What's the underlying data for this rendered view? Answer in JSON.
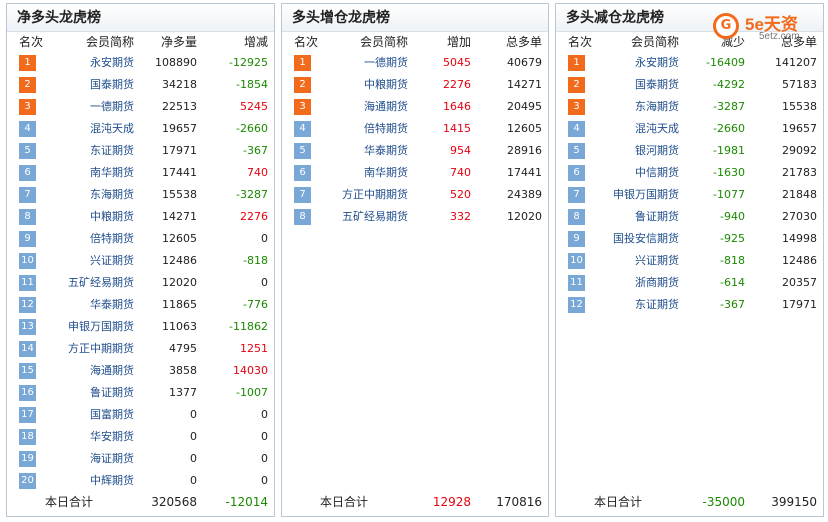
{
  "panels": [
    {
      "title": "净多头龙虎榜",
      "headers": [
        "名次",
        "会员简称",
        "净多量",
        "增减"
      ],
      "rows": [
        {
          "rank": "1",
          "name": "永安期货",
          "v1": "108890",
          "v2": "-12925",
          "c2": "green"
        },
        {
          "rank": "2",
          "name": "国泰期货",
          "v1": "34218",
          "v2": "-1854",
          "c2": "green"
        },
        {
          "rank": "3",
          "name": "一德期货",
          "v1": "22513",
          "v2": "5245",
          "c2": "red"
        },
        {
          "rank": "4",
          "name": "混沌天成",
          "v1": "19657",
          "v2": "-2660",
          "c2": "green"
        },
        {
          "rank": "5",
          "name": "东证期货",
          "v1": "17971",
          "v2": "-367",
          "c2": "green"
        },
        {
          "rank": "6",
          "name": "南华期货",
          "v1": "17441",
          "v2": "740",
          "c2": "red"
        },
        {
          "rank": "7",
          "name": "东海期货",
          "v1": "15538",
          "v2": "-3287",
          "c2": "green"
        },
        {
          "rank": "8",
          "name": "中粮期货",
          "v1": "14271",
          "v2": "2276",
          "c2": "red"
        },
        {
          "rank": "9",
          "name": "倍特期货",
          "v1": "12605",
          "v2": "0",
          "c2": "black"
        },
        {
          "rank": "10",
          "name": "兴证期货",
          "v1": "12486",
          "v2": "-818",
          "c2": "green"
        },
        {
          "rank": "11",
          "name": "五矿经易期货",
          "v1": "12020",
          "v2": "0",
          "c2": "black"
        },
        {
          "rank": "12",
          "name": "华泰期货",
          "v1": "11865",
          "v2": "-776",
          "c2": "green"
        },
        {
          "rank": "13",
          "name": "申银万国期货",
          "v1": "11063",
          "v2": "-11862",
          "c2": "green"
        },
        {
          "rank": "14",
          "name": "方正中期期货",
          "v1": "4795",
          "v2": "1251",
          "c2": "red"
        },
        {
          "rank": "15",
          "name": "海通期货",
          "v1": "3858",
          "v2": "14030",
          "c2": "red"
        },
        {
          "rank": "16",
          "name": "鲁证期货",
          "v1": "1377",
          "v2": "-1007",
          "c2": "green"
        },
        {
          "rank": "17",
          "name": "国富期货",
          "v1": "0",
          "v2": "0",
          "c2": "black"
        },
        {
          "rank": "18",
          "name": "华安期货",
          "v1": "0",
          "v2": "0",
          "c2": "black"
        },
        {
          "rank": "19",
          "name": "海证期货",
          "v1": "0",
          "v2": "0",
          "c2": "black"
        },
        {
          "rank": "20",
          "name": "中辉期货",
          "v1": "0",
          "v2": "0",
          "c2": "black"
        }
      ],
      "total": {
        "label": "本日合计",
        "v1": "320568",
        "v2": "-12014",
        "c1": "black",
        "c2": "green"
      }
    },
    {
      "title": "多头增仓龙虎榜",
      "headers": [
        "名次",
        "会员简称",
        "增加",
        "总多单"
      ],
      "rows": [
        {
          "rank": "1",
          "name": "一德期货",
          "v1": "5045",
          "v2": "40679",
          "c1": "red"
        },
        {
          "rank": "2",
          "name": "中粮期货",
          "v1": "2276",
          "v2": "14271",
          "c1": "red"
        },
        {
          "rank": "3",
          "name": "海通期货",
          "v1": "1646",
          "v2": "20495",
          "c1": "red"
        },
        {
          "rank": "4",
          "name": "倍特期货",
          "v1": "1415",
          "v2": "12605",
          "c1": "red"
        },
        {
          "rank": "5",
          "name": "华泰期货",
          "v1": "954",
          "v2": "28916",
          "c1": "red"
        },
        {
          "rank": "6",
          "name": "南华期货",
          "v1": "740",
          "v2": "17441",
          "c1": "red"
        },
        {
          "rank": "7",
          "name": "方正中期期货",
          "v1": "520",
          "v2": "24389",
          "c1": "red"
        },
        {
          "rank": "8",
          "name": "五矿经易期货",
          "v1": "332",
          "v2": "12020",
          "c1": "red"
        }
      ],
      "total": {
        "label": "本日合计",
        "v1": "12928",
        "v2": "170816",
        "c1": "red",
        "c2": "black"
      }
    },
    {
      "title": "多头减仓龙虎榜",
      "headers": [
        "名次",
        "会员简称",
        "减少",
        "总多单"
      ],
      "rows": [
        {
          "rank": "1",
          "name": "永安期货",
          "v1": "-16409",
          "v2": "141207",
          "c1": "green"
        },
        {
          "rank": "2",
          "name": "国泰期货",
          "v1": "-4292",
          "v2": "57183",
          "c1": "green"
        },
        {
          "rank": "3",
          "name": "东海期货",
          "v1": "-3287",
          "v2": "15538",
          "c1": "green"
        },
        {
          "rank": "4",
          "name": "混沌天成",
          "v1": "-2660",
          "v2": "19657",
          "c1": "green"
        },
        {
          "rank": "5",
          "name": "银河期货",
          "v1": "-1981",
          "v2": "29092",
          "c1": "green"
        },
        {
          "rank": "6",
          "name": "中信期货",
          "v1": "-1630",
          "v2": "21783",
          "c1": "green"
        },
        {
          "rank": "7",
          "name": "申银万国期货",
          "v1": "-1077",
          "v2": "21848",
          "c1": "green"
        },
        {
          "rank": "8",
          "name": "鲁证期货",
          "v1": "-940",
          "v2": "27030",
          "c1": "green"
        },
        {
          "rank": "9",
          "name": "国投安信期货",
          "v1": "-925",
          "v2": "14998",
          "c1": "green"
        },
        {
          "rank": "10",
          "name": "兴证期货",
          "v1": "-818",
          "v2": "12486",
          "c1": "green"
        },
        {
          "rank": "11",
          "name": "浙商期货",
          "v1": "-614",
          "v2": "20357",
          "c1": "green"
        },
        {
          "rank": "12",
          "name": "东证期货",
          "v1": "-367",
          "v2": "17971",
          "c1": "green"
        }
      ],
      "total": {
        "label": "本日合计",
        "v1": "-35000",
        "v2": "399150",
        "c1": "green",
        "c2": "black"
      }
    }
  ],
  "logo": {
    "icon": "5e-logo-icon",
    "symbol": "G",
    "main": "5e天资",
    "sub": "5etz.com"
  },
  "colors": {
    "top_badge": "#f26b1d",
    "badge": "#79a7d6",
    "name": "#1f4d8c",
    "up": "#e4000f",
    "down": "#1a8a00"
  }
}
